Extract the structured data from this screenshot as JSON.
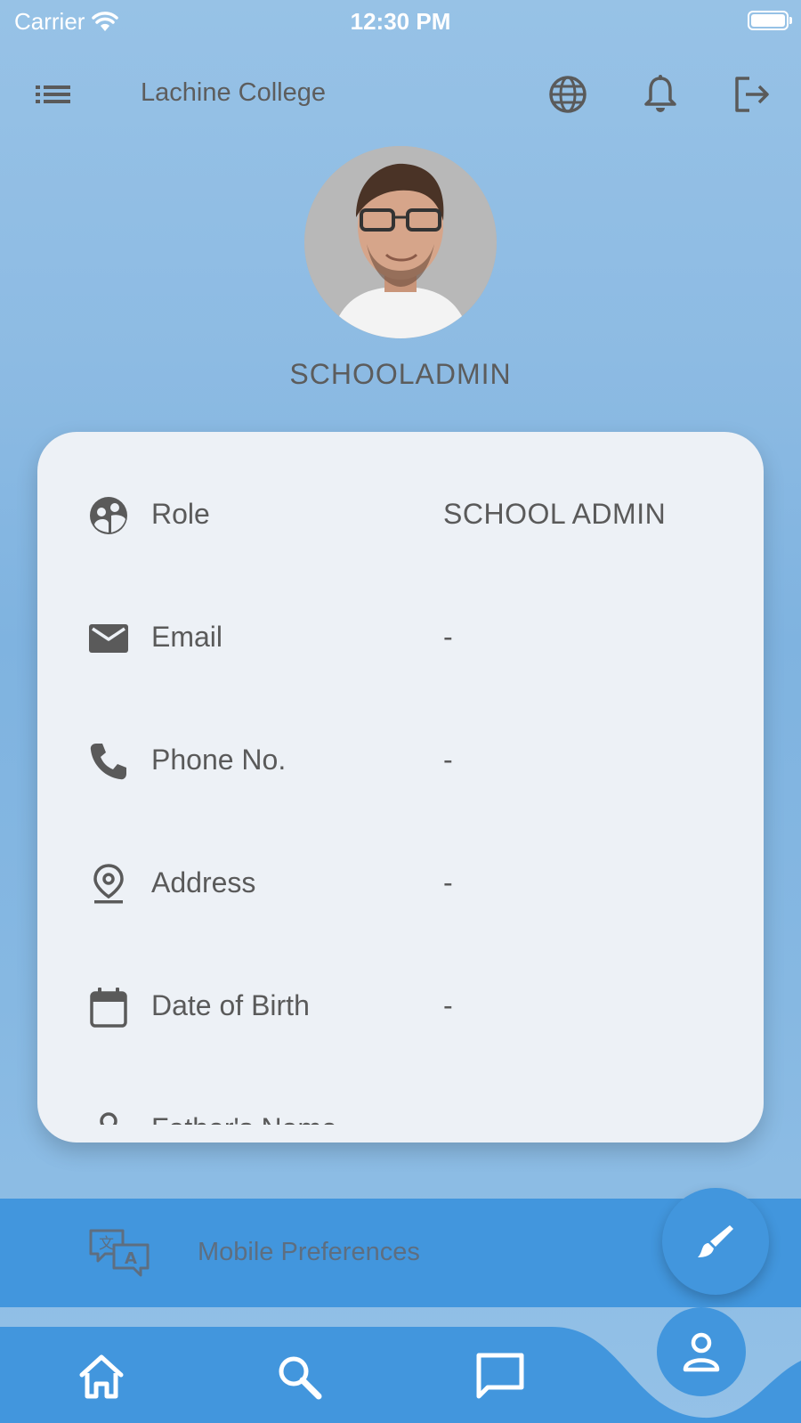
{
  "status_bar": {
    "carrier": "Carrier",
    "time": "12:30 PM"
  },
  "header": {
    "title": "Lachine College",
    "icons": [
      "menu-icon",
      "globe-icon",
      "bell-icon",
      "logout-icon"
    ]
  },
  "profile": {
    "username": "SCHOOLADMIN"
  },
  "details": {
    "role": {
      "label": "Role",
      "value": "SCHOOL ADMIN",
      "icon": "role-icon"
    },
    "email": {
      "label": "Email",
      "value": "-",
      "icon": "email-icon"
    },
    "phone": {
      "label": "Phone No.",
      "value": "-",
      "icon": "phone-icon"
    },
    "address": {
      "label": "Address",
      "value": "-",
      "icon": "location-icon"
    },
    "dob": {
      "label": "Date of Birth",
      "value": "-",
      "icon": "calendar-icon"
    },
    "partial": {
      "label": "Father's Name",
      "icon": "person-icon"
    }
  },
  "preferences": {
    "label": "Mobile Preferences",
    "icon": "translate-icon"
  },
  "bottom_nav": {
    "items": [
      "home-icon",
      "search-icon",
      "chat-icon",
      "profile-icon"
    ]
  },
  "colors": {
    "accent": "#4296dd",
    "card": "#edf1f6",
    "text": "#5a5a5a"
  }
}
